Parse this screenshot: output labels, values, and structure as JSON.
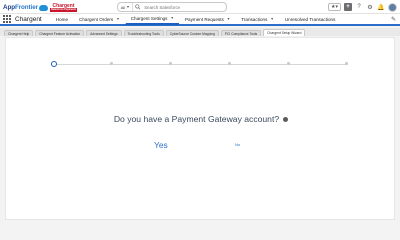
{
  "header": {
    "logo": {
      "part1": "App",
      "part2": "Frontier",
      "brand": "Chargent",
      "brand_sub": "Salesforce Payments"
    },
    "search": {
      "scope": "All",
      "placeholder": "Search Salesforce"
    },
    "icons": [
      "star-icon",
      "add-icon",
      "help-icon",
      "gear-icon",
      "bell-icon",
      "avatar"
    ]
  },
  "nav": {
    "app_name": "Chargent",
    "items": [
      {
        "label": "Home",
        "has_menu": false
      },
      {
        "label": "Chargent Orders",
        "has_menu": true
      },
      {
        "label": "Chargent Settings",
        "has_menu": true
      },
      {
        "label": "Payment Requests",
        "has_menu": true
      },
      {
        "label": "Transactions",
        "has_menu": true
      },
      {
        "label": "Unresolved Transactions",
        "has_menu": false
      }
    ],
    "active_index": 2
  },
  "subtabs": [
    "Chargent Help",
    "Chargent Feature Activation",
    "Advanced Settings",
    "Troubleshooting Tools",
    "CyberSource Custom Mapping",
    "PCI Compliance Tools",
    "Chargent Setup Wizard"
  ],
  "subtab_active_index": 6,
  "wizard": {
    "question": "Do you have a Payment Gateway account?",
    "yes_label": "Yes",
    "no_label": "No",
    "steps_total": 6,
    "current_step": 1
  },
  "colors": {
    "accent": "#1b5fbf",
    "link": "#2b6ec9",
    "question_text": "#3a4a5e"
  }
}
